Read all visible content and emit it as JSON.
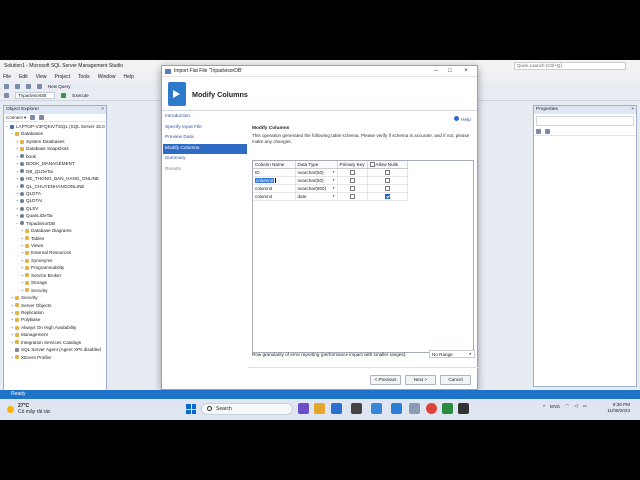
{
  "window": {
    "title": "Solution1 - Microsoft SQL Server Management Studio",
    "quick_launch_placeholder": "Quick Launch (Ctrl+Q)"
  },
  "menu": [
    "File",
    "Edit",
    "View",
    "Project",
    "Tools",
    "Window",
    "Help"
  ],
  "toolbar": {
    "new_query": "New Query",
    "db_selector": "TripadvisorDB",
    "execute": "Execute"
  },
  "object_explorer": {
    "title": "Object Explorer",
    "connect": "Connect ▾",
    "nodes": [
      {
        "label": "LAPTOP-V3FQKIV7\\SQL (SQL Server 15.0",
        "icon": "server",
        "indent": 0,
        "exp": "−"
      },
      {
        "label": "Databases",
        "icon": "folder",
        "indent": 1,
        "exp": "−"
      },
      {
        "label": "System Databases",
        "icon": "folder",
        "indent": 2,
        "exp": "+"
      },
      {
        "label": "Database Snapshots",
        "icon": "folder",
        "indent": 2,
        "exp": "+"
      },
      {
        "label": "book",
        "icon": "db",
        "indent": 2,
        "exp": "+"
      },
      {
        "label": "BOOK_MANAGEMENT",
        "icon": "db",
        "indent": 2,
        "exp": "+"
      },
      {
        "label": "DB_QLDeTai",
        "icon": "db",
        "indent": 2,
        "exp": "+"
      },
      {
        "label": "HE_THONG_BAN_HANG_ONLINE",
        "icon": "db",
        "indent": 2,
        "exp": "+"
      },
      {
        "label": "QL_CHUYENHANGONLINE",
        "icon": "db",
        "indent": 2,
        "exp": "+"
      },
      {
        "label": "QLDTA",
        "icon": "db",
        "indent": 2,
        "exp": "+"
      },
      {
        "label": "QLDTAI",
        "icon": "db",
        "indent": 2,
        "exp": "+"
      },
      {
        "label": "QLSV",
        "icon": "db",
        "indent": 2,
        "exp": "+"
      },
      {
        "label": "QuanLiDeTai",
        "icon": "db",
        "indent": 2,
        "exp": "+"
      },
      {
        "label": "TripadvisorDB",
        "icon": "db",
        "indent": 2,
        "exp": "−"
      },
      {
        "label": "Database Diagrams",
        "icon": "folder",
        "indent": 3,
        "exp": "+"
      },
      {
        "label": "Tables",
        "icon": "folder",
        "indent": 3,
        "exp": "+"
      },
      {
        "label": "Views",
        "icon": "folder",
        "indent": 3,
        "exp": "+"
      },
      {
        "label": "External Resources",
        "icon": "folder",
        "indent": 3,
        "exp": "+"
      },
      {
        "label": "Synonyms",
        "icon": "folder",
        "indent": 3,
        "exp": "+"
      },
      {
        "label": "Programmability",
        "icon": "folder",
        "indent": 3,
        "exp": "+"
      },
      {
        "label": "Service Broker",
        "icon": "folder",
        "indent": 3,
        "exp": "+"
      },
      {
        "label": "Storage",
        "icon": "folder",
        "indent": 3,
        "exp": "+"
      },
      {
        "label": "Security",
        "icon": "folder",
        "indent": 3,
        "exp": "+"
      },
      {
        "label": "Security",
        "icon": "folder",
        "indent": 1,
        "exp": "+"
      },
      {
        "label": "Server Objects",
        "icon": "folder",
        "indent": 1,
        "exp": "+"
      },
      {
        "label": "Replication",
        "icon": "folder",
        "indent": 1,
        "exp": "+"
      },
      {
        "label": "PolyBase",
        "icon": "folder",
        "indent": 1,
        "exp": "+"
      },
      {
        "label": "Always On High Availability",
        "icon": "folder",
        "indent": 1,
        "exp": "+"
      },
      {
        "label": "Management",
        "icon": "folder",
        "indent": 1,
        "exp": "+"
      },
      {
        "label": "Integration Services Catalogs",
        "icon": "folder",
        "indent": 1,
        "exp": "+"
      },
      {
        "label": "SQL Server Agent (Agent XPs disabled",
        "icon": "agent",
        "indent": 1,
        "exp": ""
      },
      {
        "label": "XEvent Profiler",
        "icon": "folder",
        "indent": 1,
        "exp": "+"
      }
    ]
  },
  "properties": {
    "title": "Properties"
  },
  "dialog": {
    "title": "Import Flat File 'TripadvisorDB'",
    "header": "Modify Columns",
    "help": "Help",
    "nav": [
      {
        "label": "Introduction",
        "state": "normal"
      },
      {
        "label": "Specify Input File",
        "state": "normal"
      },
      {
        "label": "Preview Data",
        "state": "normal"
      },
      {
        "label": "Modify Columns",
        "state": "active"
      },
      {
        "label": "Summary",
        "state": "normal"
      },
      {
        "label": "Results",
        "state": "dim"
      }
    ],
    "section_title": "Modify Columns",
    "description": "This operation generated the following table schema. Please verify if schema is accurate, and if not, please make any changes.",
    "columns_header": {
      "name": "Column Name",
      "type": "Data Type",
      "pk": "Primary Key",
      "nulls": "Allow Nulls"
    },
    "rows": [
      {
        "name": "ID",
        "type": "nvarchar(50)",
        "pk": false,
        "nulls": false,
        "selected": false
      },
      {
        "name": "column2",
        "type": "nvarchar(50)",
        "pk": false,
        "nulls": false,
        "selected": true
      },
      {
        "name": "column3",
        "type": "nvarchar(800)",
        "pk": false,
        "nulls": false,
        "selected": false
      },
      {
        "name": "column4",
        "type": "date",
        "pk": false,
        "nulls": true,
        "selected": false
      }
    ],
    "row_granularity_label": "Row granularity of error reporting (performance impact with smaller ranges):",
    "row_granularity_value": "No Range",
    "buttons": {
      "previous": "< Previous",
      "next": "Next >",
      "cancel": "Cancel"
    }
  },
  "status": "Ready",
  "taskbar": {
    "temp": "27°C",
    "weather": "Có mây rải rác",
    "search": "Search",
    "lang": "ENG",
    "time": "9:26 PM",
    "date": "11/08/2023"
  }
}
